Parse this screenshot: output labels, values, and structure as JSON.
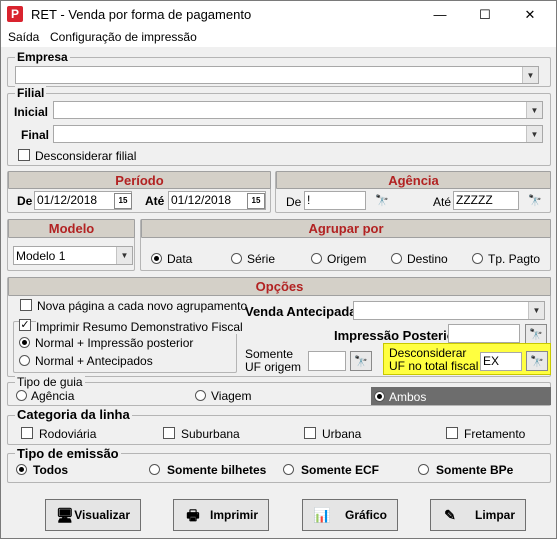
{
  "window": {
    "app_icon": "P",
    "title": "RET - Venda por forma de pagamento",
    "minimize": "—",
    "maximize": "☐",
    "close": "✕"
  },
  "menu": {
    "items": [
      "Saída",
      "Configuração de impressão"
    ]
  },
  "empresa": {
    "legend": "Empresa"
  },
  "filial": {
    "legend": "Filial",
    "inicial_label": "Inicial",
    "final_label": "Final",
    "desconsiderar_label": "Desconsiderar filial"
  },
  "periodo": {
    "header": "Período",
    "de_label": "De",
    "de_value": "01/12/2018",
    "ate_label": "Até",
    "ate_value": "01/12/2018",
    "calendar_icon": "15"
  },
  "agencia": {
    "header": "Agência",
    "de_label": "De",
    "de_value": "!",
    "ate_label": "Até",
    "ate_value": "ZZZZZ"
  },
  "modelo": {
    "header": "Modelo",
    "value": "Modelo 1"
  },
  "agrupar": {
    "header": "Agrupar por",
    "options": [
      "Data",
      "Série",
      "Origem",
      "Destino",
      "Tp. Pagto"
    ],
    "selected": "Data"
  },
  "opcoes": {
    "header": "Opções",
    "nova_pagina": "Nova página a cada novo agrupamento",
    "imprimir_resumo": "Imprimir Resumo Demonstrativo Fiscal",
    "normal_impressao": "Normal + Impressão posterior",
    "normal_antecipados": "Normal + Antecipados",
    "venda_antecipada": "Venda Antecipada",
    "impressao_posterior": "Impressão Posterior",
    "somente_uf_origem": "Somente UF origem",
    "desconsiderar_uf": "Desconsiderar UF no total fiscal",
    "desconsiderar_uf_value": "EX",
    "highlight_color": "#ffff40"
  },
  "tipo_guia": {
    "legend": "Tipo de guia",
    "options": [
      "Agência",
      "Viagem",
      "Ambos"
    ],
    "selected": "Ambos"
  },
  "categoria": {
    "legend": "Categoria da linha",
    "options": [
      "Rodoviária",
      "Suburbana",
      "Urbana",
      "Fretamento"
    ]
  },
  "tipo_emissao": {
    "legend": "Tipo de emissão",
    "options": [
      "Todos",
      "Somente bilhetes",
      "Somente ECF",
      "Somente BPe"
    ],
    "selected": "Todos"
  },
  "buttons": {
    "visualizar": "Visualizar",
    "imprimir": "Imprimir",
    "grafico": "Gráfico",
    "limpar": "Limpar"
  }
}
